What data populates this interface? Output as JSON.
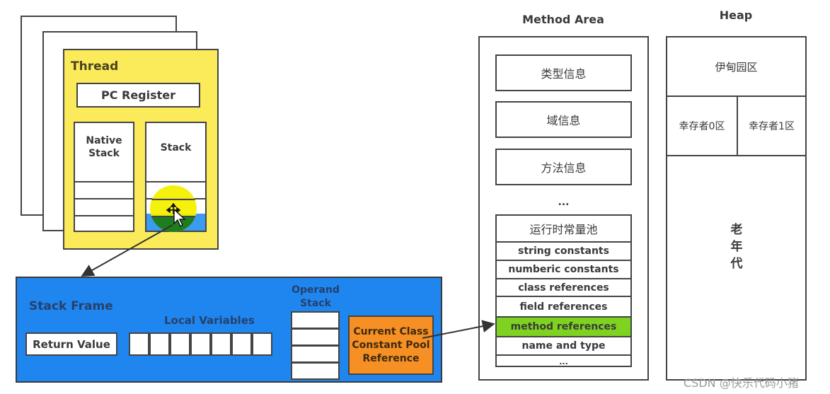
{
  "thread": {
    "title": "Thread",
    "pc_register": "PC Register",
    "native_stack_line1": "Native",
    "native_stack_line2": "Stack",
    "stack": "Stack"
  },
  "stack_frame": {
    "title": "Stack Frame",
    "return_value": "Return Value",
    "local_variables": "Local Variables",
    "local_variable_slots": 7,
    "operand_stack_line1": "Operand",
    "operand_stack_line2": "Stack",
    "operand_stack_slots": 4,
    "ccp_line1": "Current Class",
    "ccp_line2": "Constant Pool",
    "ccp_line3": "Reference"
  },
  "method_area": {
    "title": "Method Area",
    "items": [
      "类型信息",
      "域信息",
      "方法信息"
    ],
    "ellipsis": "...",
    "runtime_constant_pool": {
      "title": "运行时常量池",
      "rows": [
        "string constants",
        "numberic constants",
        "class references",
        "field references",
        "method references",
        "name and type",
        "..."
      ],
      "highlighted_row": "method references"
    }
  },
  "heap": {
    "title": "Heap",
    "eden": "伊甸园区",
    "survivor0": "幸存者0区",
    "survivor1": "幸存者1区",
    "old_gen": [
      "老",
      "年",
      "代"
    ]
  },
  "colors": {
    "thread_fill": "#fbea5a",
    "frame_fill": "#1f86ef",
    "ccp_fill": "#f68f24",
    "highlight_fill": "#7ed321",
    "stack_slot_highlight": "#3a9bf0"
  },
  "watermark": "CSDN @快乐代码小猪"
}
